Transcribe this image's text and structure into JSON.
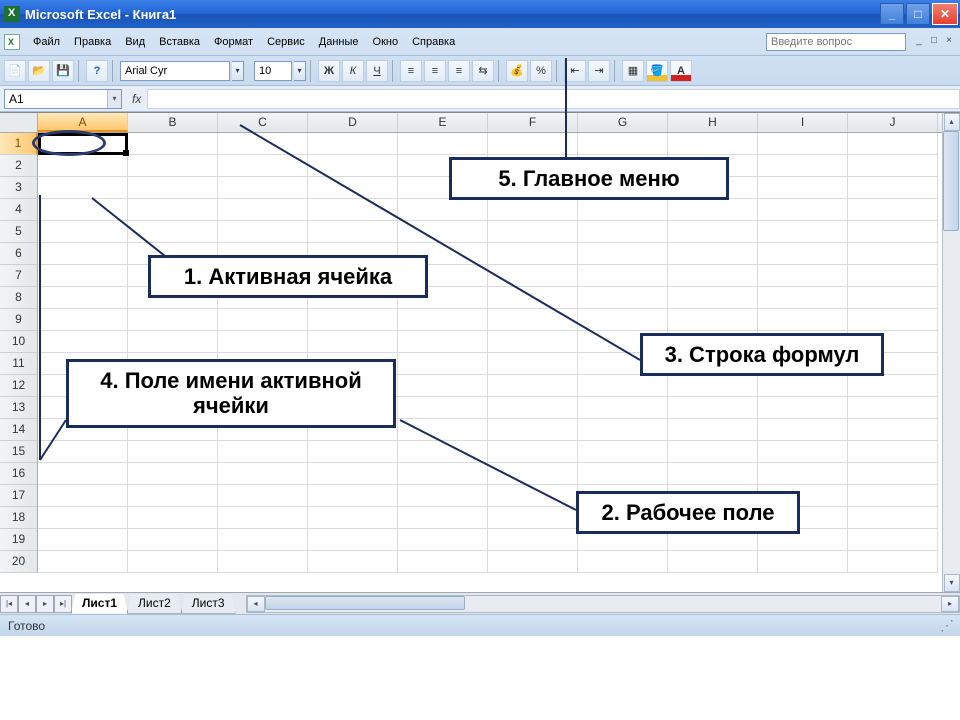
{
  "title": "Microsoft Excel - Книга1",
  "menubar": {
    "items": [
      "Файл",
      "Правка",
      "Вид",
      "Вставка",
      "Формат",
      "Сервис",
      "Данные",
      "Окно",
      "Справка"
    ],
    "question_placeholder": "Введите вопрос"
  },
  "formatting": {
    "font_name": "Arial Cyr",
    "font_size": "10"
  },
  "name_box": "A1",
  "fx_label": "fx",
  "columns": [
    "A",
    "B",
    "C",
    "D",
    "E",
    "F",
    "G",
    "H",
    "I",
    "J"
  ],
  "rows": [
    "1",
    "2",
    "3",
    "4",
    "5",
    "6",
    "7",
    "8",
    "9",
    "10",
    "11",
    "12",
    "13",
    "14",
    "15",
    "16",
    "17",
    "18",
    "19",
    "20"
  ],
  "active_col": 0,
  "active_row": 0,
  "sheets": {
    "tabs": [
      "Лист1",
      "Лист2",
      "Лист3"
    ],
    "active": 0
  },
  "status": "Готово",
  "callouts": {
    "c1": "1.  Активная ячейка",
    "c2": "2. Рабочее поле",
    "c3": "3. Строка формул",
    "c4": "4. Поле имени активной ячейки",
    "c5": "5. Главное меню"
  }
}
